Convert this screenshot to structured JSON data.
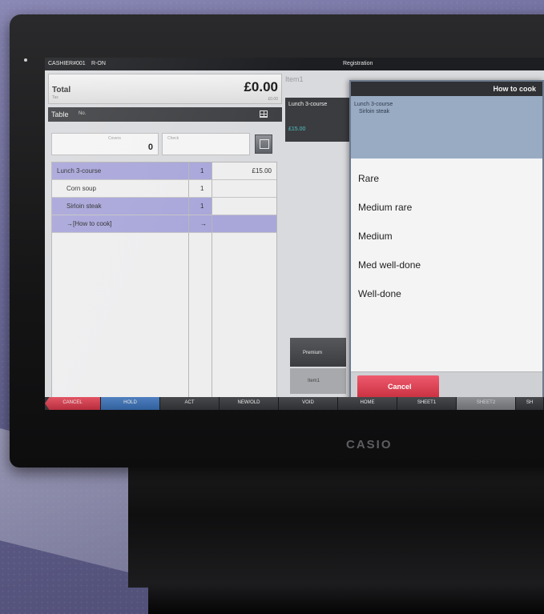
{
  "status_bar": {
    "cashier": "CASHIER#001",
    "mode": "R-ON",
    "screen": "Registration"
  },
  "total": {
    "label": "Total",
    "tax_label": "Tax",
    "value": "£0.00",
    "sub_value": "£0.00"
  },
  "table_bar": {
    "label": "Table",
    "number": "No."
  },
  "counters": {
    "covers_label": "Covers",
    "covers_value": "0",
    "check_label": "Check"
  },
  "order_rows": [
    {
      "name": "Lunch 3-course",
      "qty": "1",
      "price": "£15.00"
    },
    {
      "name": "Corn soup",
      "qty": "1",
      "price": ""
    },
    {
      "name": "Sirloin steak",
      "qty": "1",
      "price": ""
    },
    {
      "name": "→[How to cook]",
      "qty": "→",
      "price": ""
    }
  ],
  "item_panel": {
    "header": "Item1",
    "name": "Lunch 3-course",
    "price": "£15.00",
    "premium_label": "Premium",
    "item1_label": "Item1"
  },
  "dialog": {
    "title": "How to cook",
    "info_line1": "Lunch 3-course",
    "info_line2": "Sirloin steak",
    "options": [
      "Rare",
      "Medium rare",
      "Medium",
      "Med well-done",
      "Well-done"
    ],
    "cancel_label": "Cancel"
  },
  "bottom_bar": [
    "CANCEL",
    "HOLD",
    "ACT",
    "NEW/OLD",
    "VOID",
    "HOME",
    "SHEET1",
    "SHEET2",
    "SH"
  ],
  "brand": "CASIO",
  "colors": {
    "selected_row": "#a9a6da",
    "cancel_red": "#e24f5f",
    "hold_blue": "#4f7fbf",
    "price_teal": "#4cc4c7"
  }
}
